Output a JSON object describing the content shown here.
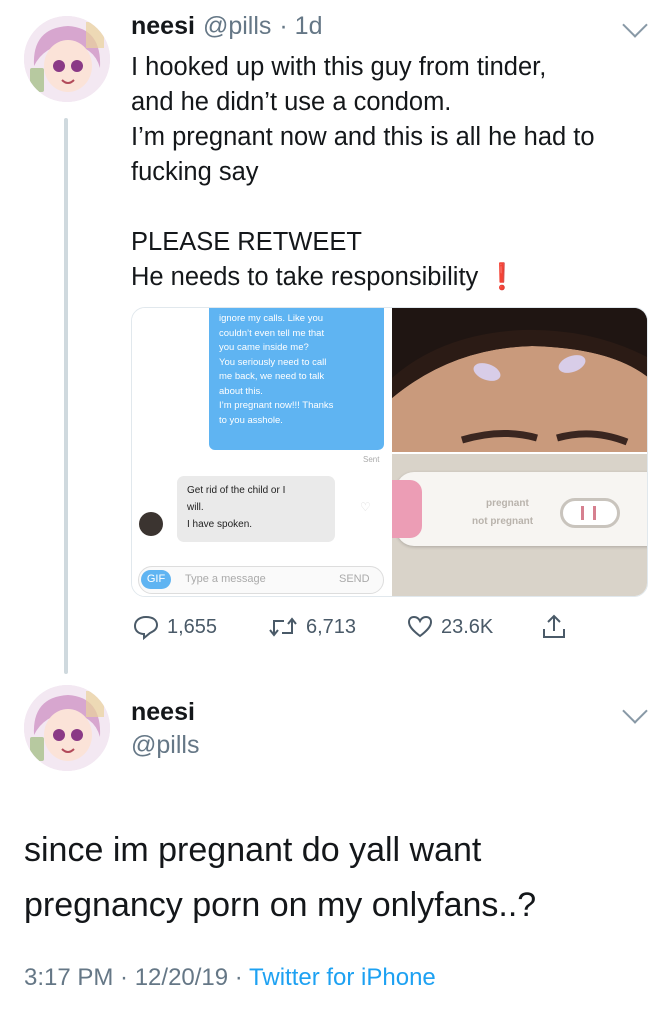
{
  "tweet1": {
    "name": "neesi",
    "handle": "@pills",
    "time": "· 1d",
    "text": "I hooked up with this guy from tinder,\nand he didn’t use a condom.\nI’m pregnant now and this is all he had to\nfucking say",
    "line2": "PLEASE RETWEET",
    "line3": "He needs to take responsibility",
    "emoji": "❗",
    "media": {
      "chat": {
        "sent_text": "ignore my calls. Like you\ncouldn’t even tell me that\nyou came inside me?\nYou seriously need to call\nme back, we need to talk\nabout this.\nI’m pregnant now!!! Thanks\nto you asshole.",
        "sent_status": "Sent",
        "received_text": "Get rid of the child or I\nwill.\nI have spoken.",
        "gif_label": "GIF",
        "input_placeholder": "Type a message",
        "send_label": "SEND"
      },
      "test_labels": {
        "pregnant": "pregnant",
        "not_pregnant": "not pregnant"
      }
    },
    "actions": {
      "replies": "1,655",
      "retweets": "6,713",
      "likes": "23.6K"
    },
    "accent_color": "#e0245e"
  },
  "tweet2": {
    "name": "neesi",
    "handle": "@pills",
    "text": "since im pregnant do yall want\npregnancy porn on my onlyfans..?",
    "timestamp": "3:17 PM · 12/20/19 · ",
    "source": "Twitter for iPhone",
    "link_color": "#1da1f2"
  }
}
